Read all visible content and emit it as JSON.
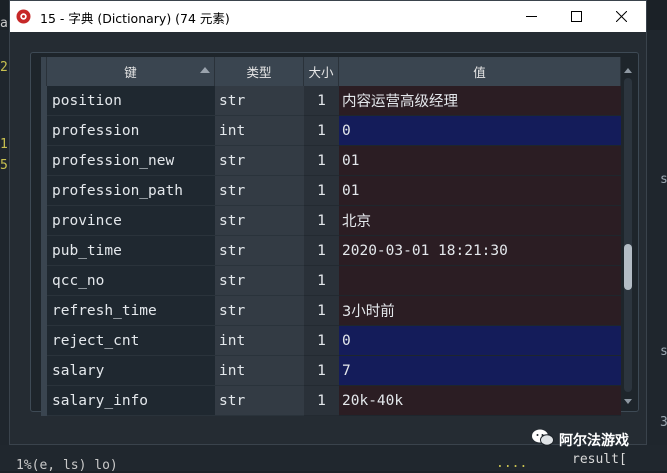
{
  "window": {
    "title": "15 - 字典 (Dictionary) (74 元素)"
  },
  "table": {
    "headers": {
      "key": "键",
      "type": "类型",
      "size": "大小",
      "value": "值"
    },
    "rows": [
      {
        "key": "position",
        "type": "str",
        "size": "1",
        "value": "内容运营高级经理"
      },
      {
        "key": "profession",
        "type": "int",
        "size": "1",
        "value": "0"
      },
      {
        "key": "profession_new",
        "type": "str",
        "size": "1",
        "value": "01"
      },
      {
        "key": "profession_path",
        "type": "str",
        "size": "1",
        "value": "01"
      },
      {
        "key": "province",
        "type": "str",
        "size": "1",
        "value": "北京"
      },
      {
        "key": "pub_time",
        "type": "str",
        "size": "1",
        "value": "2020-03-01 18:21:30"
      },
      {
        "key": "qcc_no",
        "type": "str",
        "size": "1",
        "value": ""
      },
      {
        "key": "refresh_time",
        "type": "str",
        "size": "1",
        "value": "3小时前"
      },
      {
        "key": "reject_cnt",
        "type": "int",
        "size": "1",
        "value": "0"
      },
      {
        "key": "salary",
        "type": "int",
        "size": "1",
        "value": "7"
      },
      {
        "key": "salary_info",
        "type": "str",
        "size": "1",
        "value": "20k-40k"
      }
    ]
  },
  "scrollbar": {
    "position_fraction": 0.62
  },
  "watermark": {
    "text": "阿尔法游戏"
  },
  "background": {
    "fragments": [
      "a",
      "2",
      "1",
      "5",
      "s",
      "s",
      "3",
      "result[",
      "....",
      "1%(e, ls) lo)"
    ]
  },
  "colors": {
    "str_value_bg": "#2b1d23",
    "int_value_bg": "#141c5a",
    "header_bg": "#3a4550",
    "window_bg": "#252c33"
  },
  "icons": {
    "app": "spyder-icon",
    "minimize": "minimize-icon",
    "maximize": "maximize-icon",
    "close": "close-icon",
    "sort": "sort-ascending-icon",
    "watermark": "wechat-icon"
  }
}
